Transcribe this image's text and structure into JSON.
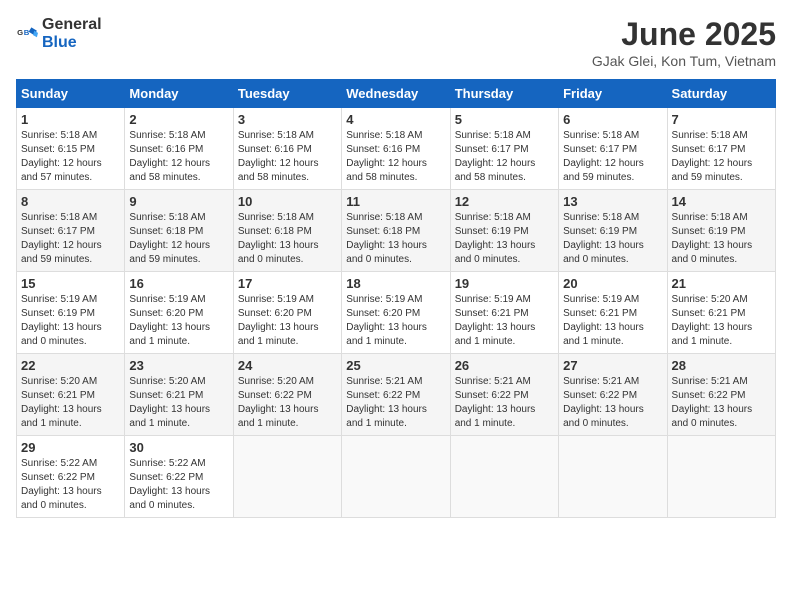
{
  "header": {
    "logo_general": "General",
    "logo_blue": "Blue",
    "month": "June 2025",
    "location": "GJak Glei, Kon Tum, Vietnam"
  },
  "weekdays": [
    "Sunday",
    "Monday",
    "Tuesday",
    "Wednesday",
    "Thursday",
    "Friday",
    "Saturday"
  ],
  "weeks": [
    [
      {
        "day": "1",
        "sunrise": "5:18 AM",
        "sunset": "6:15 PM",
        "daylight": "12 hours and 57 minutes."
      },
      {
        "day": "2",
        "sunrise": "5:18 AM",
        "sunset": "6:16 PM",
        "daylight": "12 hours and 58 minutes."
      },
      {
        "day": "3",
        "sunrise": "5:18 AM",
        "sunset": "6:16 PM",
        "daylight": "12 hours and 58 minutes."
      },
      {
        "day": "4",
        "sunrise": "5:18 AM",
        "sunset": "6:16 PM",
        "daylight": "12 hours and 58 minutes."
      },
      {
        "day": "5",
        "sunrise": "5:18 AM",
        "sunset": "6:17 PM",
        "daylight": "12 hours and 58 minutes."
      },
      {
        "day": "6",
        "sunrise": "5:18 AM",
        "sunset": "6:17 PM",
        "daylight": "12 hours and 59 minutes."
      },
      {
        "day": "7",
        "sunrise": "5:18 AM",
        "sunset": "6:17 PM",
        "daylight": "12 hours and 59 minutes."
      }
    ],
    [
      {
        "day": "8",
        "sunrise": "5:18 AM",
        "sunset": "6:17 PM",
        "daylight": "12 hours and 59 minutes."
      },
      {
        "day": "9",
        "sunrise": "5:18 AM",
        "sunset": "6:18 PM",
        "daylight": "12 hours and 59 minutes."
      },
      {
        "day": "10",
        "sunrise": "5:18 AM",
        "sunset": "6:18 PM",
        "daylight": "13 hours and 0 minutes."
      },
      {
        "day": "11",
        "sunrise": "5:18 AM",
        "sunset": "6:18 PM",
        "daylight": "13 hours and 0 minutes."
      },
      {
        "day": "12",
        "sunrise": "5:18 AM",
        "sunset": "6:19 PM",
        "daylight": "13 hours and 0 minutes."
      },
      {
        "day": "13",
        "sunrise": "5:18 AM",
        "sunset": "6:19 PM",
        "daylight": "13 hours and 0 minutes."
      },
      {
        "day": "14",
        "sunrise": "5:18 AM",
        "sunset": "6:19 PM",
        "daylight": "13 hours and 0 minutes."
      }
    ],
    [
      {
        "day": "15",
        "sunrise": "5:19 AM",
        "sunset": "6:19 PM",
        "daylight": "13 hours and 0 minutes."
      },
      {
        "day": "16",
        "sunrise": "5:19 AM",
        "sunset": "6:20 PM",
        "daylight": "13 hours and 1 minute."
      },
      {
        "day": "17",
        "sunrise": "5:19 AM",
        "sunset": "6:20 PM",
        "daylight": "13 hours and 1 minute."
      },
      {
        "day": "18",
        "sunrise": "5:19 AM",
        "sunset": "6:20 PM",
        "daylight": "13 hours and 1 minute."
      },
      {
        "day": "19",
        "sunrise": "5:19 AM",
        "sunset": "6:21 PM",
        "daylight": "13 hours and 1 minute."
      },
      {
        "day": "20",
        "sunrise": "5:19 AM",
        "sunset": "6:21 PM",
        "daylight": "13 hours and 1 minute."
      },
      {
        "day": "21",
        "sunrise": "5:20 AM",
        "sunset": "6:21 PM",
        "daylight": "13 hours and 1 minute."
      }
    ],
    [
      {
        "day": "22",
        "sunrise": "5:20 AM",
        "sunset": "6:21 PM",
        "daylight": "13 hours and 1 minute."
      },
      {
        "day": "23",
        "sunrise": "5:20 AM",
        "sunset": "6:21 PM",
        "daylight": "13 hours and 1 minute."
      },
      {
        "day": "24",
        "sunrise": "5:20 AM",
        "sunset": "6:22 PM",
        "daylight": "13 hours and 1 minute."
      },
      {
        "day": "25",
        "sunrise": "5:21 AM",
        "sunset": "6:22 PM",
        "daylight": "13 hours and 1 minute."
      },
      {
        "day": "26",
        "sunrise": "5:21 AM",
        "sunset": "6:22 PM",
        "daylight": "13 hours and 1 minute."
      },
      {
        "day": "27",
        "sunrise": "5:21 AM",
        "sunset": "6:22 PM",
        "daylight": "13 hours and 0 minutes."
      },
      {
        "day": "28",
        "sunrise": "5:21 AM",
        "sunset": "6:22 PM",
        "daylight": "13 hours and 0 minutes."
      }
    ],
    [
      {
        "day": "29",
        "sunrise": "5:22 AM",
        "sunset": "6:22 PM",
        "daylight": "13 hours and 0 minutes."
      },
      {
        "day": "30",
        "sunrise": "5:22 AM",
        "sunset": "6:22 PM",
        "daylight": "13 hours and 0 minutes."
      },
      null,
      null,
      null,
      null,
      null
    ]
  ]
}
